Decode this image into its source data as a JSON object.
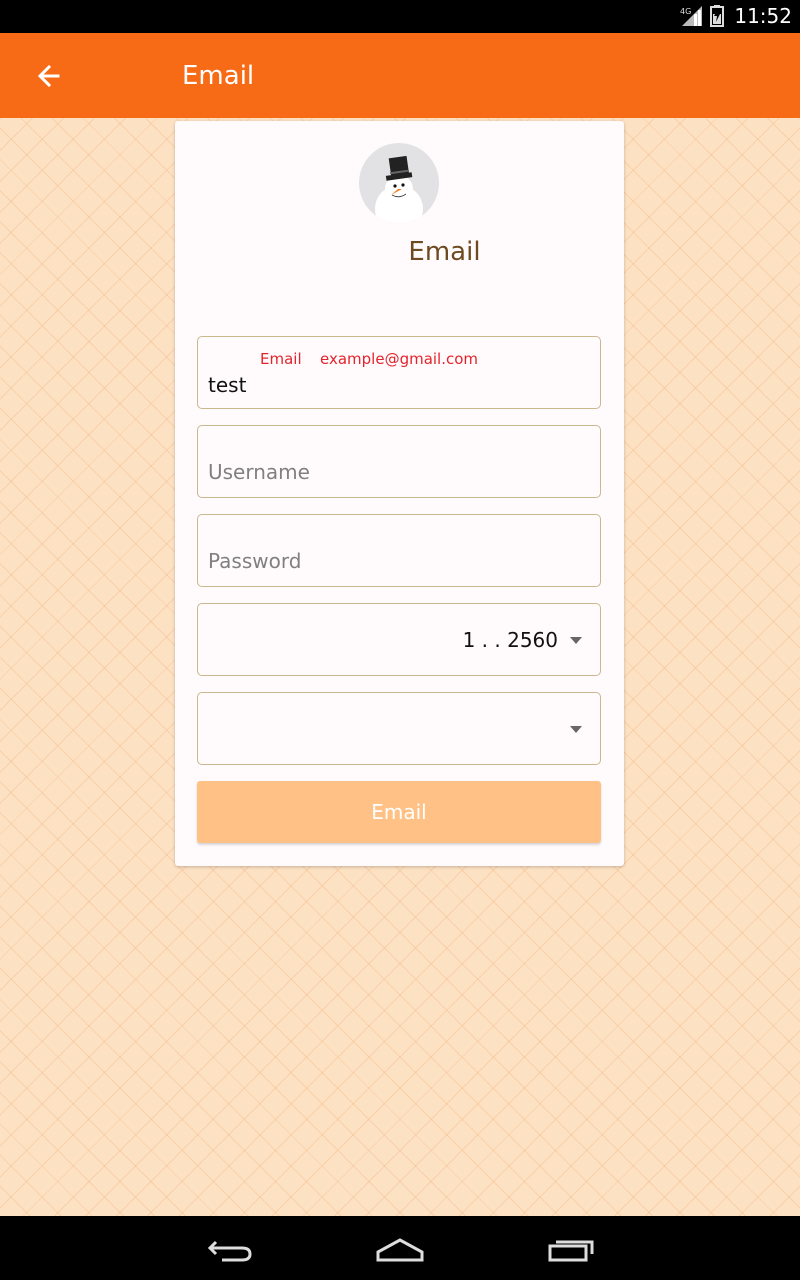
{
  "status_bar": {
    "time": "11:52",
    "network": "4G",
    "icons": [
      "signal-icon",
      "battery-icon"
    ]
  },
  "app_bar": {
    "title": "Email",
    "back_icon": "arrow-left-icon",
    "color": "#f76b16"
  },
  "card": {
    "avatar": "snowman-avatar",
    "title": "Email"
  },
  "form": {
    "email": {
      "error_label": "Email",
      "error_hint": "example@gmail.com",
      "value": "test"
    },
    "username": {
      "placeholder": "Username"
    },
    "password": {
      "placeholder": "Password"
    },
    "date": {
      "value": "1  . . 2560"
    },
    "select": {
      "value": ""
    },
    "submit_label": "Email"
  },
  "colors": {
    "accent": "#f76b16",
    "button": "#ffc185",
    "error": "#e3242b",
    "title_text": "#6e4a22"
  },
  "nav_bar": {
    "icons": [
      "back-nav-icon",
      "home-nav-icon",
      "recents-nav-icon"
    ]
  }
}
